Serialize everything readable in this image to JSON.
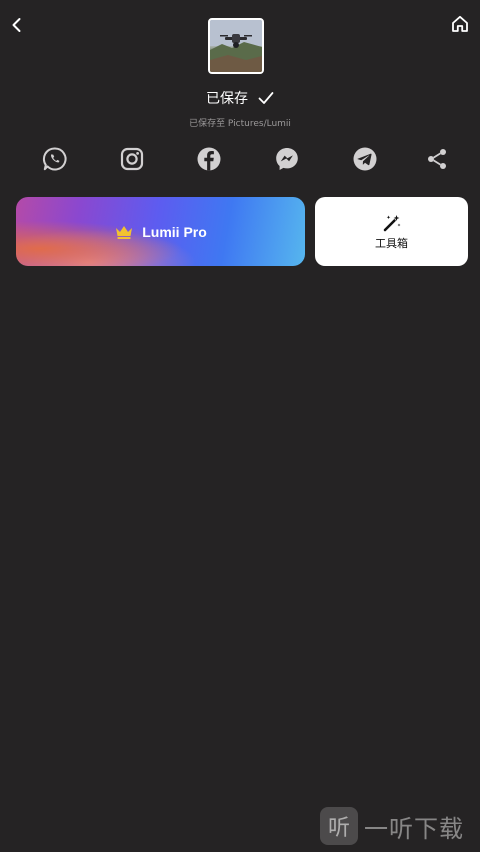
{
  "header": {
    "back_icon": "chevron-left-icon",
    "home_icon": "home-icon"
  },
  "saved": {
    "title": "已保存",
    "check_icon": "checkmark-icon",
    "path": "已保存至 Pictures/Lumii"
  },
  "share": {
    "items": [
      {
        "icon": "whatsapp-icon"
      },
      {
        "icon": "instagram-icon"
      },
      {
        "icon": "facebook-icon"
      },
      {
        "icon": "messenger-icon"
      },
      {
        "icon": "telegram-icon"
      },
      {
        "icon": "share-icon"
      }
    ]
  },
  "actions": {
    "pro_label": "Lumii Pro",
    "pro_icon": "crown-icon",
    "toolbox_label": "工具箱",
    "toolbox_icon": "magic-wand-icon"
  },
  "watermark": {
    "glyph": "听",
    "text": "一听下载"
  },
  "colors": {
    "background": "#252324",
    "icon_gray": "#d2d0d1",
    "crown_gold": "#f2c230"
  }
}
